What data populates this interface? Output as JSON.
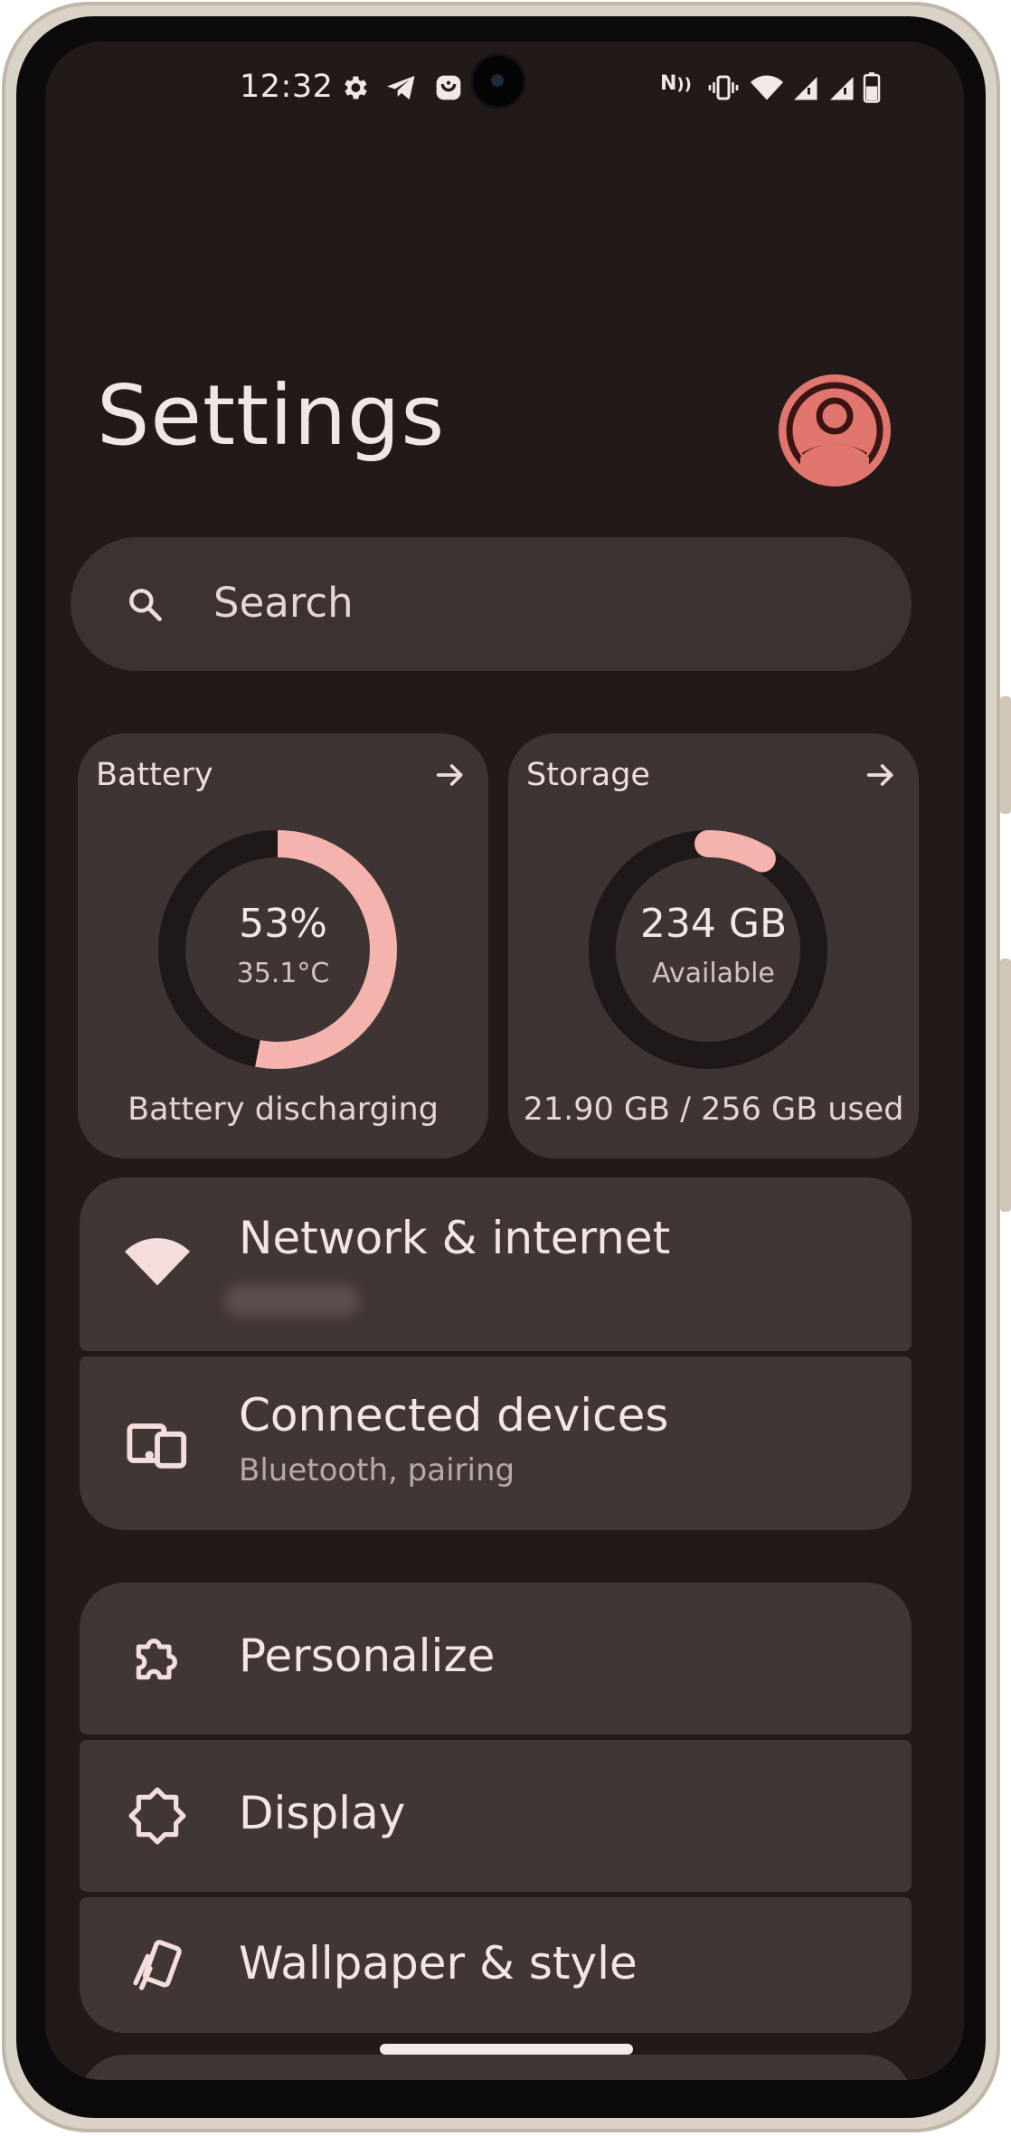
{
  "status_bar": {
    "time": "12:32",
    "left_icons": [
      "gear-icon",
      "telegram-icon",
      "app-notification-icon"
    ],
    "right_icons": [
      "nfc-icon",
      "vibrate-icon",
      "wifi-icon",
      "signal-icon",
      "signal-icon",
      "battery-icon"
    ],
    "nfc_label": "N"
  },
  "header": {
    "title": "Settings"
  },
  "search": {
    "placeholder": "Search"
  },
  "cards": {
    "battery": {
      "title": "Battery",
      "percent": "53%",
      "temperature": "35.1°C",
      "status": "Battery discharging",
      "level": 0.53
    },
    "storage": {
      "title": "Storage",
      "available": "234 GB",
      "available_label": "Available",
      "usage": "21.90 GB / 256 GB used",
      "used_fraction": 0.0855
    }
  },
  "items": [
    {
      "title": "Network & internet",
      "subtitle": "",
      "icon": "wifi-icon"
    },
    {
      "title": "Connected devices",
      "subtitle": "Bluetooth, pairing",
      "icon": "devices-icon"
    },
    {
      "title": "Personalize",
      "icon": "puzzle-icon"
    },
    {
      "title": "Display",
      "icon": "brightness-icon"
    },
    {
      "title": "Wallpaper & style",
      "icon": "wallpaper-icon"
    }
  ],
  "colors": {
    "background": "#211a19",
    "card": "#3f3434",
    "accent": "#f4b3ad",
    "avatar": "#e0766d"
  }
}
